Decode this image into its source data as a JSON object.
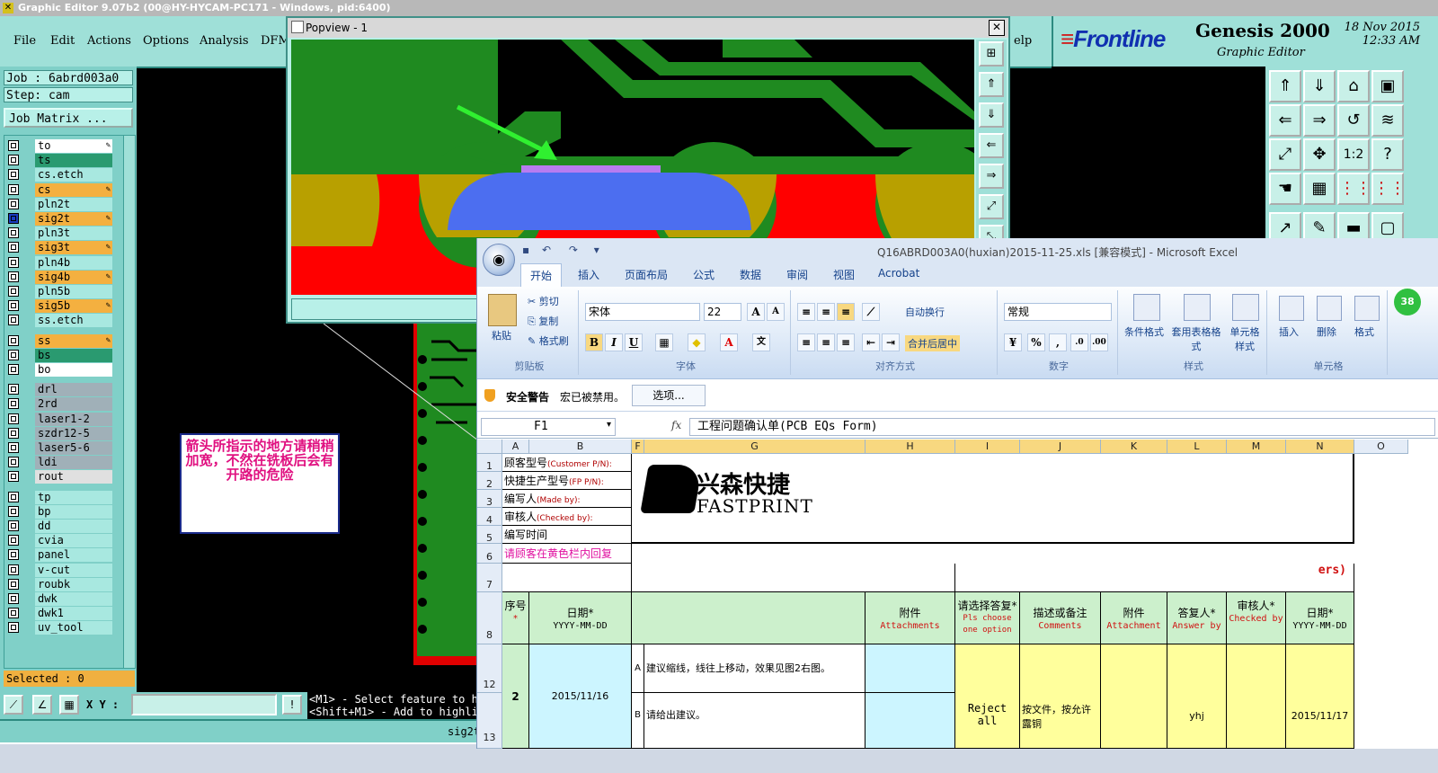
{
  "genesis": {
    "title": "Graphic Editor 9.07b2 (00@HY-HYCAM-PC171 - Windows, pid:6400)",
    "menu": [
      "File",
      "Edit",
      "Actions",
      "Options",
      "Analysis",
      "DFM",
      "elp"
    ],
    "brand": {
      "logo": "Frontline",
      "product": "Genesis 2000",
      "subtitle": "Graphic Editor",
      "date": "18 Nov 2015",
      "time": "12:33 AM"
    },
    "job": "Job : 6abrd003a0",
    "step": "Step: cam",
    "job_matrix": "Job Matrix ...",
    "layers": [
      {
        "name": "to",
        "color": "#ffffff",
        "icon": "pencil-icon"
      },
      {
        "name": "ts",
        "color": "#2a9a70",
        "icon": ""
      },
      {
        "name": "cs.etch",
        "color": "#a8e8e0",
        "icon": ""
      },
      {
        "name": "cs",
        "color": "#f4b040",
        "icon": "pencil-icon"
      },
      {
        "name": "pln2t",
        "color": "#a8e8e0",
        "icon": ""
      },
      {
        "name": "sig2t",
        "color": "#f4b040",
        "icon": "pencil-icon"
      },
      {
        "name": "pln3t",
        "color": "#a8e8e0",
        "icon": ""
      },
      {
        "name": "sig3t",
        "color": "#f4b040",
        "icon": "pencil-icon"
      },
      {
        "name": "pln4b",
        "color": "#a8e8e0",
        "icon": ""
      },
      {
        "name": "sig4b",
        "color": "#f4b040",
        "icon": "pencil-icon"
      },
      {
        "name": "pln5b",
        "color": "#a8e8e0",
        "icon": ""
      },
      {
        "name": "sig5b",
        "color": "#f4b040",
        "icon": "pencil-icon"
      },
      {
        "name": "ss.etch",
        "color": "#a8e8e0",
        "icon": ""
      },
      {
        "name": "ss",
        "color": "#f4b040",
        "icon": "pencil-icon"
      },
      {
        "name": "bs",
        "color": "#2a9a70",
        "icon": ""
      },
      {
        "name": "bo",
        "color": "#ffffff",
        "icon": ""
      },
      {
        "name": "drl",
        "color": "#a0b0b8",
        "icon": ""
      },
      {
        "name": "2rd",
        "color": "#a0b0b8",
        "icon": ""
      },
      {
        "name": "laser1-2",
        "color": "#a0b0b8",
        "icon": ""
      },
      {
        "name": "szdr12-5",
        "color": "#a0b0b8",
        "icon": ""
      },
      {
        "name": "laser5-6",
        "color": "#a0b0b8",
        "icon": ""
      },
      {
        "name": "ldi",
        "color": "#a0b0b8",
        "icon": ""
      },
      {
        "name": "rout",
        "color": "#e0e0e0",
        "icon": ""
      },
      {
        "name": "tp",
        "color": "#a8e8e0",
        "icon": ""
      },
      {
        "name": "bp",
        "color": "#a8e8e0",
        "icon": ""
      },
      {
        "name": "dd",
        "color": "#a8e8e0",
        "icon": ""
      },
      {
        "name": "cvia",
        "color": "#a8e8e0",
        "icon": ""
      },
      {
        "name": "panel",
        "color": "#a8e8e0",
        "icon": ""
      },
      {
        "name": "v-cut",
        "color": "#a8e8e0",
        "icon": ""
      },
      {
        "name": "roubk",
        "color": "#a8e8e0",
        "icon": ""
      },
      {
        "name": "dwk",
        "color": "#a8e8e0",
        "icon": ""
      },
      {
        "name": "dwk1",
        "color": "#a8e8e0",
        "icon": ""
      },
      {
        "name": "uv_tool",
        "color": "#a8e8e0",
        "icon": ""
      }
    ],
    "selected": "Selected : 0",
    "xy_label": "X Y :",
    "message_line1": "<M1> - Select feature to hi",
    "message_line2": "<Shift+M1> - Add to highlig",
    "status_layer": "sig2t"
  },
  "popview": {
    "title": "Popview - 1",
    "close": "✕",
    "note": "箭头所指示的地方请稍稍加宽，不然在铣板后会有开路的危险"
  },
  "excel": {
    "title": "Q16ABRD003A0(huxian)2015-11-25.xls [兼容模式] - Microsoft Excel",
    "tabs": [
      "开始",
      "插入",
      "页面布局",
      "公式",
      "数据",
      "审阅",
      "视图",
      "Acrobat"
    ],
    "clipboard": {
      "paste": "粘贴",
      "cut": "剪切",
      "copy": "复制",
      "format_painter": "格式刷",
      "label": "剪贴板"
    },
    "font": {
      "name": "宋体",
      "size": "22",
      "label": "字体"
    },
    "align": {
      "wrap": "自动换行",
      "merge": "合并后居中",
      "label": "对齐方式"
    },
    "number": {
      "format": "常规",
      "label": "数字"
    },
    "styles": {
      "cond": "条件格式",
      "table": "套用表格格式",
      "cell": "单元格样式",
      "label": "样式"
    },
    "cells": {
      "insert": "插入",
      "delete": "删除",
      "format": "格式",
      "label": "单元格"
    },
    "security": {
      "label": "安全警告",
      "text": "宏已被禁用。",
      "options": "选项..."
    },
    "name_box": "F1",
    "formula": "工程问题确认单(PCB EQs Form)",
    "columns": [
      "A",
      "B",
      "F",
      "G",
      "H",
      "I",
      "J",
      "K",
      "L",
      "M",
      "N",
      "O"
    ],
    "rows": [
      "1",
      "2",
      "3",
      "4",
      "5",
      "6",
      "7",
      "8",
      "12",
      "13"
    ],
    "left_labels": [
      {
        "cn": "顾客型号",
        "en": "(Customer P/N):"
      },
      {
        "cn": "快捷生产型号",
        "en": "(FP P/N):"
      },
      {
        "cn": "编写人",
        "en": "(Made by):"
      },
      {
        "cn": "审核人",
        "en": "(Checked by):"
      },
      {
        "cn": "编写时间",
        "en": ""
      },
      {
        "cn": "请顾客在黄色栏内回复",
        "en": ""
      }
    ],
    "logo": {
      "cn": "兴森快捷",
      "en": "FASTPRINT"
    },
    "row7_tail": "ers)",
    "headers": [
      {
        "cn": "序号",
        "en": ""
      },
      {
        "cn": "日期*",
        "en": "YYYY-MM-DD"
      },
      {
        "cn": "附件",
        "en": "Attachments"
      },
      {
        "cn": "请选择答复*",
        "en": "Pls choose one option"
      },
      {
        "cn": "描述或备注",
        "en": "Comments"
      },
      {
        "cn": "附件",
        "en": "Attachment"
      },
      {
        "cn": "答复人*",
        "en": "Answer by"
      },
      {
        "cn": "审核人*",
        "en": "Checked by"
      },
      {
        "cn": "日期*",
        "en": "YYYY-MM-DD"
      }
    ],
    "item": {
      "no": "2",
      "date": "2015/11/16",
      "a_label": "A",
      "a_text": "建议缩线，线往上移动，效果见图2右图。",
      "b_label": "B",
      "b_text": "请给出建议。",
      "choice": "Reject all",
      "comment": "按文件，按允许露铜",
      "answer_by": "yhj",
      "reply_date": "2015/11/17"
    }
  }
}
